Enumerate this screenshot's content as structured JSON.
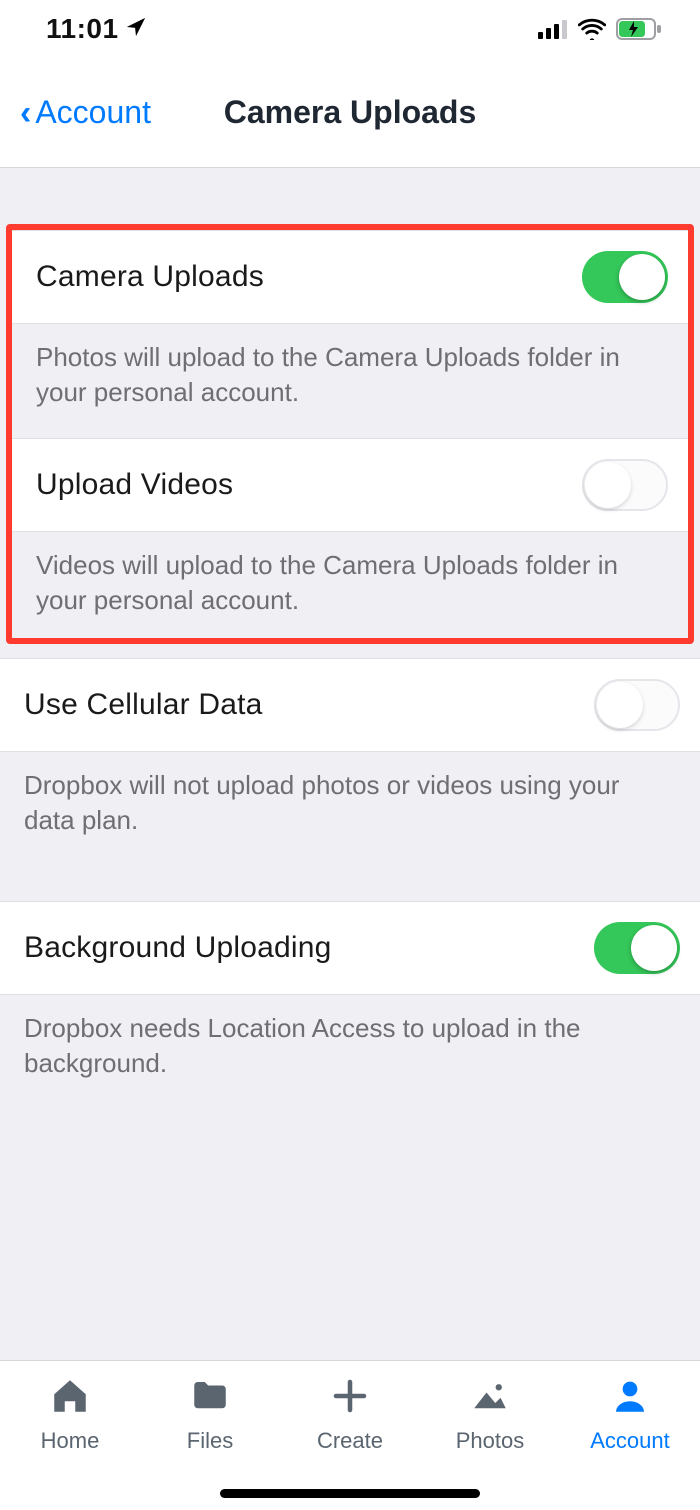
{
  "status": {
    "time": "11:01"
  },
  "header": {
    "back_label": "Account",
    "title": "Camera Uploads"
  },
  "settings": [
    {
      "label": "Camera Uploads",
      "on": true,
      "desc": "Photos will upload to the Camera Uploads folder in your personal account."
    },
    {
      "label": "Upload Videos",
      "on": false,
      "desc": "Videos will upload to the Camera Uploads folder in your personal account."
    },
    {
      "label": "Use Cellular Data",
      "on": false,
      "desc": "Dropbox will not upload photos or videos using your data plan."
    },
    {
      "label": "Background Uploading",
      "on": true,
      "desc": "Dropbox needs Location Access to upload in the background."
    }
  ],
  "tabs": [
    {
      "label": "Home"
    },
    {
      "label": "Files"
    },
    {
      "label": "Create"
    },
    {
      "label": "Photos"
    },
    {
      "label": "Account"
    }
  ]
}
